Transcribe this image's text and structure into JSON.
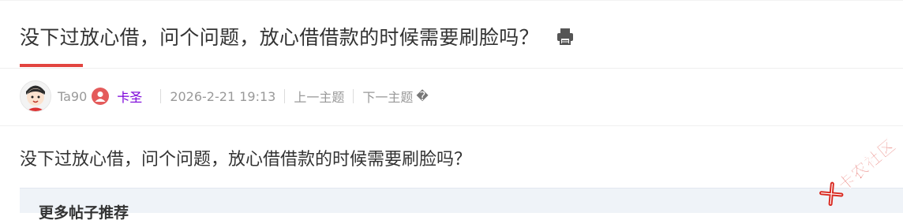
{
  "thread": {
    "title": "没下过放心借，问个问题，放心借借款的时候需要刷脸吗？",
    "author": "Ta90",
    "user_group": "卡圣",
    "datetime": "2026-2-21 19:13",
    "prev_label": "上一主题",
    "next_label": "下一主题",
    "next_icon": "�",
    "content": "没下过放心借，问个问题，放心借借款的时候需要刷脸吗？"
  },
  "recommend": {
    "title": "更多帖子推荐"
  },
  "watermark": {
    "text": "卡农社区"
  },
  "colors": {
    "accent_red": "#e2443f",
    "group_purple": "#7a00d9",
    "user_icon_red": "#e45b5b",
    "meta_gray": "#999999",
    "recommend_bg": "#eff3f8"
  },
  "icons": [
    "print-icon",
    "avatar",
    "user-icon",
    "question-mark-icon",
    "watermark-logo-icon"
  ]
}
